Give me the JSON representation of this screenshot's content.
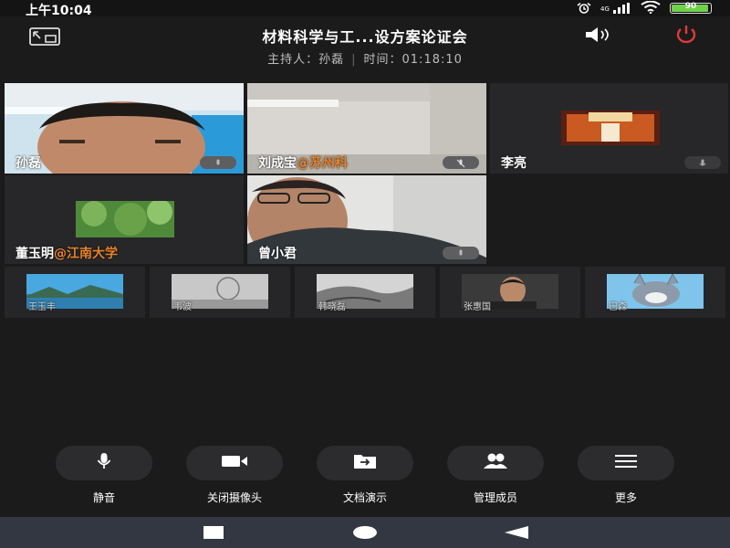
{
  "status_bar": {
    "time": "上午10:04",
    "battery": "90",
    "battery_level": 0.9
  },
  "header": {
    "title": "材料科学与工...设方案论证会",
    "host_label": "主持人：",
    "host_name": "孙磊",
    "time_label": "时间：",
    "time_value": "01:18:10"
  },
  "main_grid": {
    "tiles": [
      {
        "name": "孙磊",
        "org": ""
      },
      {
        "name": "刘成宝",
        "org": "@苏州科"
      },
      {
        "name": "李亮",
        "org": ""
      },
      {
        "name": "董玉明",
        "org": "@江南大学"
      },
      {
        "name": "曾小君",
        "org": ""
      }
    ]
  },
  "strip": {
    "items": [
      {
        "name": "王玉丰"
      },
      {
        "name": "韦波"
      },
      {
        "name": "韩晓磊"
      },
      {
        "name": "张惠国"
      },
      {
        "name": "巴森"
      }
    ]
  },
  "controls": {
    "mute": "静音",
    "camera_off": "关闭摄像头",
    "doc_share": "文档演示",
    "manage_members": "管理成员",
    "more": "更多"
  },
  "colors": {
    "org_highlight": "#e8832b",
    "power_red": "#e03a3a",
    "battery_green": "#6fd14b"
  }
}
